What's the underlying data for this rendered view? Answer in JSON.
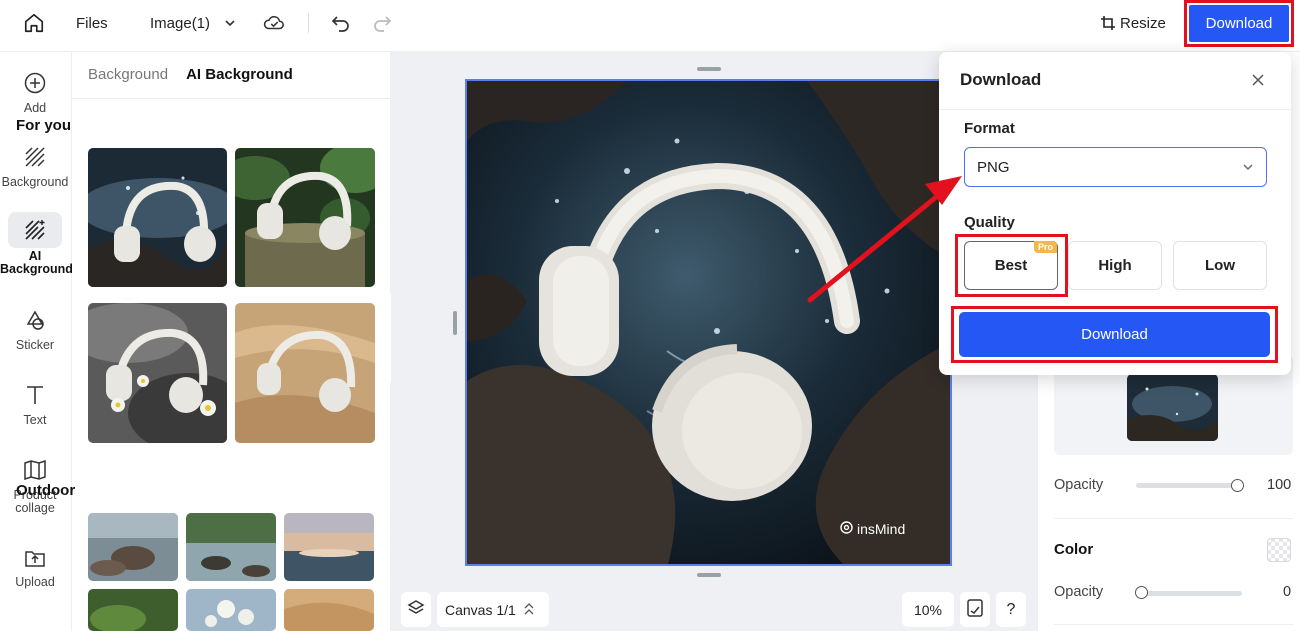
{
  "topbar": {
    "files_label": "Files",
    "image_dropdown_label": "Image(1)",
    "resize_label": "Resize",
    "download_label": "Download"
  },
  "leftnav": {
    "items": [
      {
        "label": "Add",
        "icon": "plus-circle-icon"
      },
      {
        "label": "Background",
        "icon": "hatch-icon"
      },
      {
        "label": "AI Background",
        "icon": "ai-hatch-icon",
        "active": true
      },
      {
        "label": "Sticker",
        "icon": "sticker-icon"
      },
      {
        "label": "Text",
        "icon": "text-icon"
      },
      {
        "label": "Product collage",
        "icon": "collage-icon"
      },
      {
        "label": "Upload",
        "icon": "upload-icon"
      }
    ]
  },
  "panel": {
    "tabs": [
      {
        "label": "Background",
        "active": false
      },
      {
        "label": "AI Background",
        "active": true
      }
    ],
    "for_you_title": "For you",
    "outdoor_title": "Outdoor"
  },
  "canvas": {
    "watermark": "insMind",
    "canvas_label": "Canvas 1/1",
    "zoom": "10%",
    "help": "?"
  },
  "rightpanel": {
    "opacity_label": "Opacity",
    "opacity_value": "100",
    "color_title": "Color",
    "color_opacity_label": "Opacity",
    "color_opacity_value": "0"
  },
  "download_popup": {
    "title": "Download",
    "format_label": "Format",
    "format_value": "PNG",
    "quality_label": "Quality",
    "quality_options": [
      {
        "label": "Best",
        "badge": "Pro",
        "selected": true
      },
      {
        "label": "High",
        "selected": false
      },
      {
        "label": "Low",
        "selected": false
      }
    ],
    "download_button": "Download"
  },
  "colors": {
    "accent": "#2557f5",
    "highlight": "#e3101e",
    "pro_badge": "#f2b84b"
  }
}
